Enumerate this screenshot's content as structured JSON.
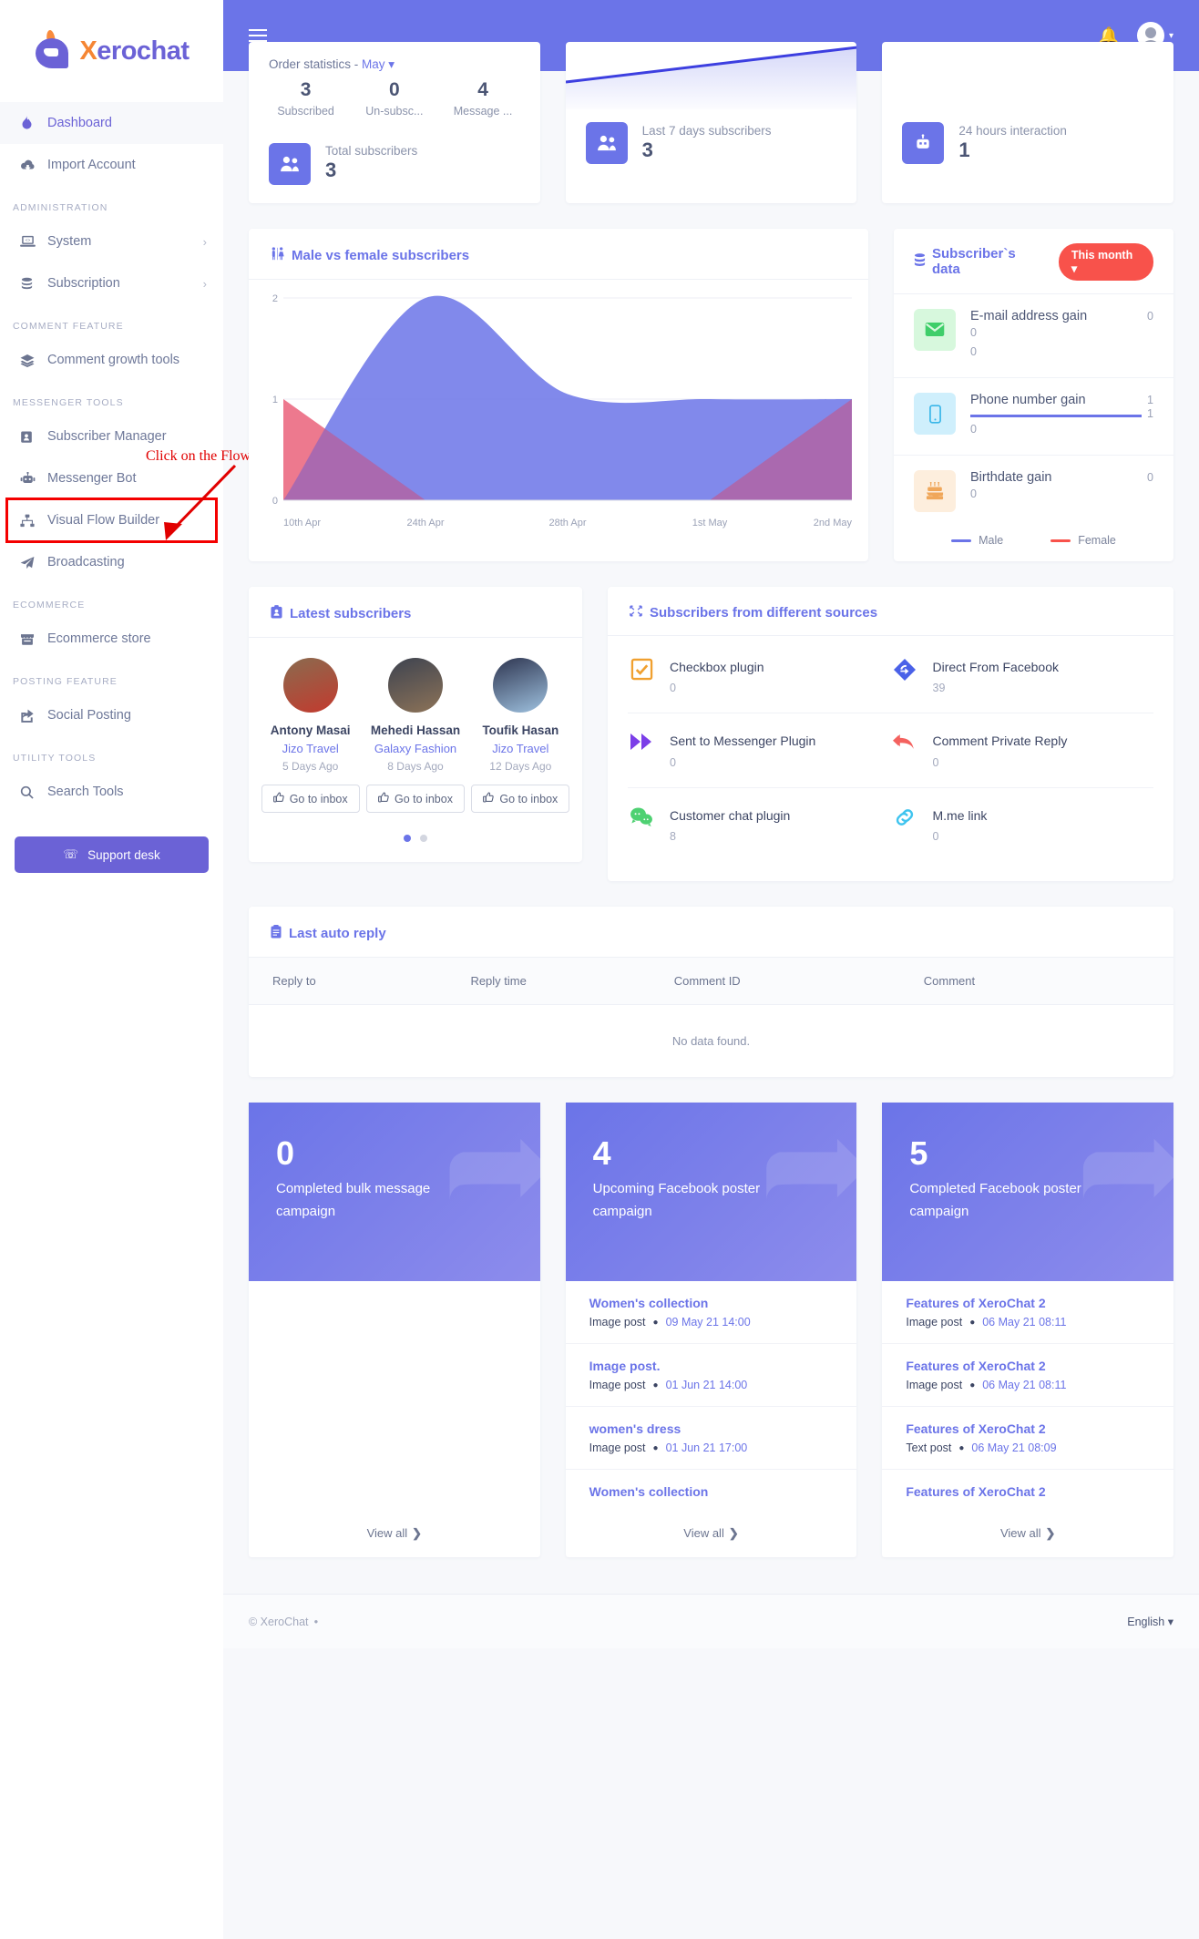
{
  "brand": {
    "x": "X",
    "name": "erochat"
  },
  "sidebar": {
    "items": [
      {
        "label": "Dashboard",
        "icon": "flame-icon",
        "active": true
      },
      {
        "label": "Import Account",
        "icon": "cloud-download-icon"
      }
    ],
    "sections": [
      {
        "label": "ADMINISTRATION",
        "items": [
          {
            "label": "System",
            "icon": "laptop-icon",
            "chevron": "›"
          },
          {
            "label": "Subscription",
            "icon": "coins-icon",
            "chevron": "›"
          }
        ]
      },
      {
        "label": "COMMENT FEATURE",
        "items": [
          {
            "label": "Comment growth tools",
            "icon": "layers-icon"
          }
        ]
      },
      {
        "label": "MESSENGER TOOLS",
        "items": [
          {
            "label": "Subscriber Manager",
            "icon": "id-card-icon"
          },
          {
            "label": "Messenger Bot",
            "icon": "robot-icon"
          },
          {
            "label": "Visual Flow Builder",
            "icon": "sitemap-icon",
            "highlighted": true
          },
          {
            "label": "Broadcasting",
            "icon": "paper-plane-icon"
          }
        ]
      },
      {
        "label": "ECOMMERCE",
        "items": [
          {
            "label": "Ecommerce store",
            "icon": "store-icon"
          }
        ]
      },
      {
        "label": "POSTING FEATURE",
        "items": [
          {
            "label": "Social Posting",
            "icon": "share-icon"
          }
        ]
      },
      {
        "label": "UTILITY TOOLS",
        "items": [
          {
            "label": "Search Tools",
            "icon": "search-icon"
          }
        ]
      }
    ],
    "support_button": "Support desk"
  },
  "annotation": {
    "text": "Click on the Flow builder",
    "color": "#e10000"
  },
  "topbar": {
    "menu_icon": "hamburger-icon",
    "bell_icon": "bell-icon",
    "avatar_icon": "user-avatar"
  },
  "stats": {
    "order": {
      "title_prefix": "Order statistics - ",
      "month": "May",
      "caret": "▾",
      "metrics": [
        {
          "value": "3",
          "label": "Subscribed"
        },
        {
          "value": "0",
          "label": "Un-subsc..."
        },
        {
          "value": "4",
          "label": "Message ..."
        }
      ],
      "foot_label": "Total subscribers",
      "foot_value": "3",
      "foot_icon": "users-icon"
    },
    "week": {
      "foot_label": "Last 7 days subscribers",
      "foot_value": "3",
      "foot_icon": "user-group-icon"
    },
    "day": {
      "foot_label": "24 hours interaction",
      "foot_value": "1",
      "foot_icon": "robot-interaction-icon"
    }
  },
  "gender_chart": {
    "title": "Male vs female subscribers",
    "icon": "male-female-icon"
  },
  "chart_data": {
    "type": "area",
    "title": "Male vs female subscribers",
    "x": [
      "10th Apr",
      "24th Apr",
      "28th Apr",
      "1st May",
      "2nd May"
    ],
    "xlabel": "",
    "ylabel": "",
    "ylim": [
      0,
      2
    ],
    "yticks": [
      0,
      1,
      2
    ],
    "grid": true,
    "legend": [
      "Male",
      "Female"
    ],
    "legend_position": "bottom",
    "series": [
      {
        "name": "Male",
        "color": "#6b74e8",
        "values": [
          0,
          2,
          1.05,
          1.0,
          1.0
        ]
      },
      {
        "name": "Female",
        "color": "#e8536d",
        "values": [
          1,
          0,
          0,
          0,
          1
        ]
      }
    ]
  },
  "subscriber_data": {
    "title": "Subscriber`s data",
    "icon": "database-icon",
    "filter": "This month",
    "filter_caret": "▾",
    "rows": [
      {
        "name": "E-mail address gain",
        "icon": "envelope-icon",
        "icon_bg": "#d7f8dd",
        "icon_color": "#3fce6a",
        "right_top": "0",
        "right_bottom": "",
        "progress": 0,
        "sub1": "0",
        "sub2": "0"
      },
      {
        "name": "Phone number gain",
        "icon": "mobile-icon",
        "icon_bg": "#cfeffc",
        "icon_color": "#39b6e8",
        "right_top": "1",
        "right_bottom": "1",
        "progress": 100,
        "sub1": "0",
        "sub2": ""
      },
      {
        "name": "Birthdate gain",
        "icon": "birthday-cake-icon",
        "icon_bg": "#fdeedd",
        "icon_color": "#f0a75a",
        "right_top": "0",
        "right_bottom": "",
        "progress": 0,
        "sub1": "0",
        "sub2": ""
      }
    ],
    "legend": [
      {
        "label": "Male",
        "color": "#6b74e8"
      },
      {
        "label": "Female",
        "color": "#f8524b"
      }
    ]
  },
  "latest_subscribers": {
    "title": "Latest subscribers",
    "icon": "id-badge-icon",
    "people": [
      {
        "name": "Antony Masai",
        "page": "Jizo Travel",
        "ago": "5 Days Ago",
        "button": "Go to inbox",
        "avatar_top": "#8a6b4f",
        "avatar_bottom": "#c33a2e"
      },
      {
        "name": "Mehedi Hassan",
        "page": "Galaxy Fashion",
        "ago": "8 Days Ago",
        "button": "Go to inbox",
        "avatar_top": "#3d4350",
        "avatar_bottom": "#8d7358"
      },
      {
        "name": "Toufik Hasan",
        "page": "Jizo Travel",
        "ago": "12 Days Ago",
        "button": "Go to inbox",
        "avatar_top": "#2e3550",
        "avatar_bottom": "#9fc2e0"
      }
    ],
    "dots": 2,
    "active_dot": 0
  },
  "sources": {
    "title": "Subscribers from different sources",
    "icon": "merge-icon",
    "items": [
      {
        "name": "Checkbox plugin",
        "value": "0",
        "icon": "checkbox-icon",
        "color": "#f0a030"
      },
      {
        "name": "Direct From Facebook",
        "value": "39",
        "icon": "direct-arrow-icon",
        "color": "#4a61e8"
      },
      {
        "name": "Sent to Messenger Plugin",
        "value": "0",
        "icon": "forward-icon",
        "color": "#7b3ee8"
      },
      {
        "name": "Comment Private Reply",
        "value": "0",
        "icon": "reply-all-icon",
        "color": "#f4625f"
      },
      {
        "name": "Customer chat plugin",
        "value": "8",
        "icon": "chat-bubbles-icon",
        "color": "#4ed172"
      },
      {
        "name": "M.me link",
        "value": "0",
        "icon": "link-icon",
        "color": "#3fc4ef"
      }
    ]
  },
  "auto_reply": {
    "title": "Last auto reply",
    "icon": "clipboard-icon",
    "columns": [
      "Reply to",
      "Reply time",
      "Comment ID",
      "Comment"
    ],
    "empty_text": "No data found."
  },
  "campaigns": [
    {
      "number": "0",
      "label": "Completed bulk message campaign",
      "items": [],
      "view_all": "View all",
      "arrow": "❯"
    },
    {
      "number": "4",
      "label": "Upcoming Facebook poster campaign",
      "items": [
        {
          "title": "Women's collection",
          "type": "Image post",
          "date": "09 May 21 14:00"
        },
        {
          "title": "Image post.",
          "type": "Image post",
          "date": "01 Jun 21 14:00"
        },
        {
          "title": "women's dress",
          "type": "Image post",
          "date": "01 Jun 21 17:00"
        },
        {
          "title": "Women's collection",
          "type": "",
          "date": ""
        }
      ],
      "view_all": "View all",
      "arrow": "❯"
    },
    {
      "number": "5",
      "label": "Completed Facebook poster campaign",
      "items": [
        {
          "title": "Features of XeroChat 2",
          "type": "Image post",
          "date": "06 May 21 08:11"
        },
        {
          "title": "Features of XeroChat 2",
          "type": "Image post",
          "date": "06 May 21 08:11"
        },
        {
          "title": "Features of XeroChat 2",
          "type": "Text post",
          "date": "06 May 21 08:09"
        },
        {
          "title": "Features of XeroChat 2",
          "type": "",
          "date": ""
        }
      ],
      "view_all": "View all",
      "arrow": "❯"
    }
  ],
  "footer": {
    "copyright": "© XeroChat",
    "bullet": "●",
    "language": "English",
    "caret": "▾"
  }
}
